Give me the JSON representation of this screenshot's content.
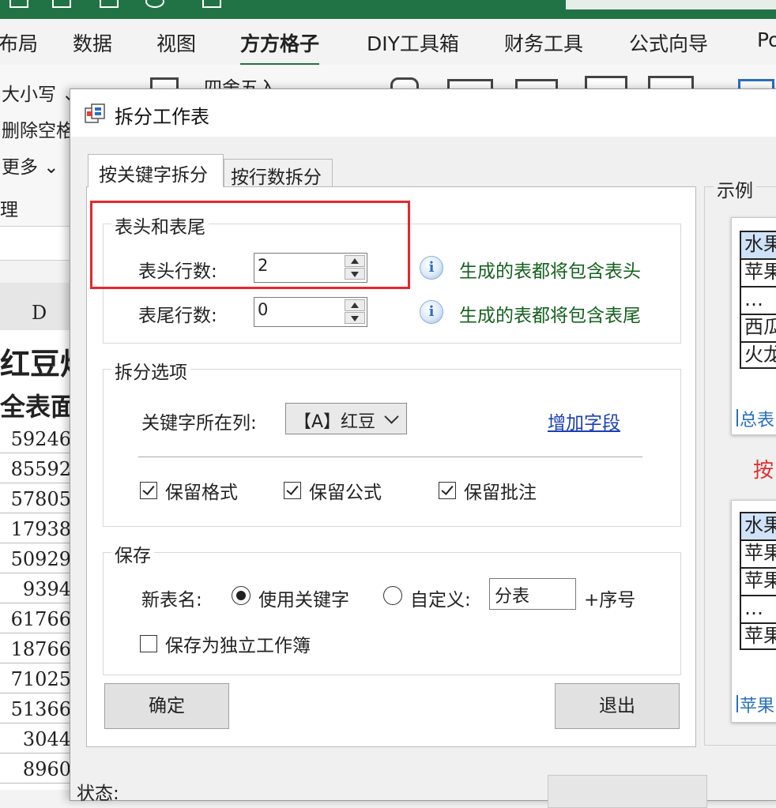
{
  "ribbon": {
    "tabs": [
      "布局",
      "数据",
      "视图",
      "方方格子",
      "DIY工具箱",
      "财务工具",
      "公式向导",
      "Po"
    ],
    "left_items": [
      "大小写 ⌄",
      "删除空格",
      "更多 ⌄",
      "理"
    ],
    "rounding_label": "四舍五入"
  },
  "sheet": {
    "column_header": "D",
    "partial_header_1": "红豆炒",
    "partial_header_2": "全表面",
    "values": [
      "59246",
      "85592",
      "57805",
      "17938",
      "50929",
      "9394",
      "61766",
      "18766",
      "71025",
      "51366",
      "3044",
      "8960"
    ]
  },
  "dialog": {
    "title": "拆分工作表",
    "tabs": {
      "by_keyword": "按关键字拆分",
      "by_rows": "按行数拆分"
    },
    "header_footer": {
      "group_title": "表头和表尾",
      "header_rows_label": "表头行数:",
      "header_rows_value": "2",
      "footer_rows_label": "表尾行数:",
      "footer_rows_value": "0",
      "header_hint": "生成的表都将包含表头",
      "footer_hint": "生成的表都将包含表尾"
    },
    "split_options": {
      "group_title": "拆分选项",
      "keyword_column_label": "关键字所在列:",
      "keyword_column_value": "【A】红豆",
      "add_field_link": "增加字段",
      "keep_format": "保留格式",
      "keep_formula": "保留公式",
      "keep_comment": "保留批注",
      "keep_format_checked": true,
      "keep_formula_checked": true,
      "keep_comment_checked": true
    },
    "save": {
      "group_title": "保存",
      "new_sheet_name_label": "新表名:",
      "use_keyword": "使用关键字",
      "custom": "自定义:",
      "custom_value": "分表",
      "suffix": "+序号",
      "save_independent": "保存为独立工作簿",
      "use_keyword_selected": true,
      "save_independent_checked": false
    },
    "buttons": {
      "ok": "确定",
      "exit": "退出"
    },
    "status_label": "状态:",
    "example": {
      "title": "示例",
      "top_rows": [
        "水果",
        "苹果",
        "…",
        "西瓜",
        "火龙"
      ],
      "top_tab": "总表",
      "arrow_text": "按",
      "bottom_rows": [
        "水果",
        "苹果",
        "苹果",
        "…",
        "苹果"
      ],
      "bottom_tab": "苹果"
    }
  },
  "colors": {
    "excel_green": "#217346",
    "highlight_red": "#e8262a",
    "hint_green": "#14621e",
    "link_blue": "#1a3fb5"
  }
}
